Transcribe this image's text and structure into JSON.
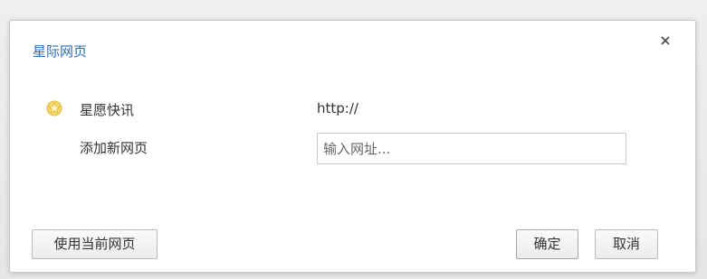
{
  "dialog": {
    "title": "星际网页",
    "close_label": "×"
  },
  "current_site": {
    "icon": "star-favicon-icon",
    "name": "星愿快讯",
    "url": "http://"
  },
  "add_page": {
    "label": "添加新网页",
    "input_value": "",
    "input_placeholder": "输入网址..."
  },
  "buttons": {
    "use_current": "使用当前网页",
    "ok": "确定",
    "cancel": "取消"
  }
}
